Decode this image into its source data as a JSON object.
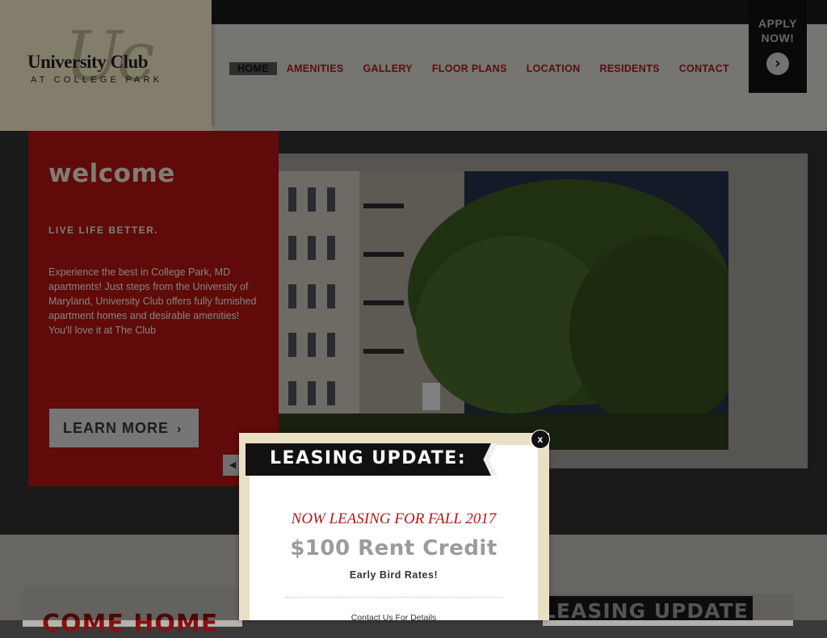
{
  "header": {
    "logo": {
      "monogram": "Uc",
      "name": "University Club",
      "tagline": "AT COLLEGE PARK"
    },
    "nav": [
      {
        "label": "HOME",
        "active": true
      },
      {
        "label": "AMENITIES"
      },
      {
        "label": "GALLERY"
      },
      {
        "label": "FLOOR PLANS"
      },
      {
        "label": "LOCATION"
      },
      {
        "label": "RESIDENTS"
      },
      {
        "label": "CONTACT"
      }
    ],
    "apply": {
      "line1": "APPLY",
      "line2": "NOW!",
      "arrow_icon": "chevron-right-icon"
    }
  },
  "hero": {
    "title": "welcome",
    "subtitle": "LIVE LIFE BETTER.",
    "body": "Experience the best in College Park, MD apartments! Just steps from the University of Maryland, University Club offers fully furnished apartment homes and desirable amenities!  You'll love it at The Club",
    "learn_more": "LEARN MORE",
    "prev_icon": "chevron-left-icon"
  },
  "lower": {
    "heading": "COME HOME",
    "banner": "LEASING UPDATE"
  },
  "popup": {
    "title": "LEASING UPDATE:",
    "close_label": "x",
    "leasing": "NOW LEASING FOR FALL 2017",
    "credit": "$100 Rent Credit",
    "early": "Early Bird Rates!",
    "contact": "Contact Us For Details"
  },
  "colors": {
    "brand_red": "#b01313",
    "nav_red": "#a11b1b",
    "logo_panel": "#efe3c3",
    "dark": "#111111"
  }
}
